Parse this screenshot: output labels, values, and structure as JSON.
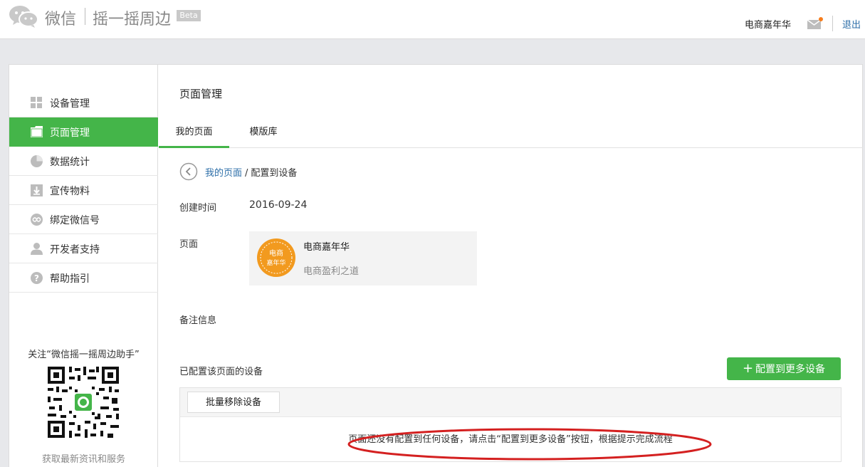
{
  "header": {
    "brand": "微信",
    "product": "摇一摇周边",
    "badge": "Beta",
    "account_name": "电商嘉年华",
    "logout": "退出",
    "colors": {
      "accent": "#44b549",
      "link": "#2c6ea8",
      "notify": "#f77d1c"
    }
  },
  "sidebar": {
    "items": [
      {
        "label": "设备管理",
        "icon": "grid-icon",
        "active": false
      },
      {
        "label": "页面管理",
        "icon": "page-icon",
        "active": true
      },
      {
        "label": "数据统计",
        "icon": "pie-chart-icon",
        "active": false
      },
      {
        "label": "宣传物料",
        "icon": "download-icon",
        "active": false
      },
      {
        "label": "绑定微信号",
        "icon": "link-icon",
        "active": false
      },
      {
        "label": "开发者支持",
        "icon": "user-icon",
        "active": false
      },
      {
        "label": "帮助指引",
        "icon": "help-icon",
        "active": false
      }
    ],
    "follow_text": "关注“微信摇一摇周边助手”",
    "promo_text": "获取最新资讯和服务"
  },
  "main": {
    "title": "页面管理",
    "tabs": [
      {
        "label": "我的页面",
        "active": true
      },
      {
        "label": "模版库",
        "active": false
      }
    ],
    "breadcrumb": {
      "link": "我的页面",
      "separator": "/",
      "current": "配置到设备"
    },
    "created_label": "创建时间",
    "created_value": "2016-09-24",
    "page_label": "页面",
    "page_card": {
      "title": "电商嘉年华",
      "subtitle": "电商盈利之道",
      "avatar_text": [
        "电商",
        "嘉年华"
      ]
    },
    "remark_label": "备注信息",
    "devices_label": "已配置该页面的设备",
    "add_button": "配置到更多设备",
    "batch_remove_button": "批量移除设备",
    "empty_message": "页面还没有配置到任何设备，请点击“配置到更多设备”按钮，根据提示完成流程"
  }
}
